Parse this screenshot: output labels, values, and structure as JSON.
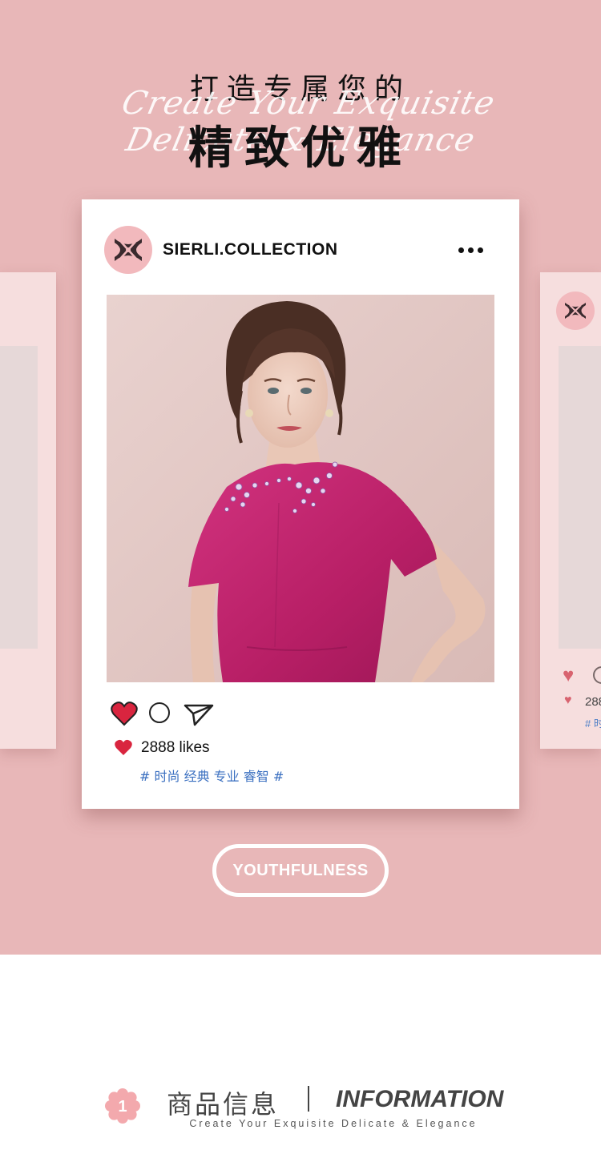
{
  "hero": {
    "title_line1": "打造专属您的",
    "script_text": "Create Your Exquisite Delicate & Elegance",
    "title_line2": "精致优雅"
  },
  "post": {
    "brand_name": "SIERLI.COLLECTION",
    "likes_text": "2888 likes",
    "hashtags": "# 时尚 经典 专业 睿智 #",
    "photo_icon": "fashion-model-photo"
  },
  "side_post": {
    "likes_text": "288",
    "hashtags": "# 时"
  },
  "pill_label": "YOUTHFULNESS",
  "info": {
    "badge_number": "1",
    "title_cn": "商品信息",
    "title_en": "INFORMATION",
    "subtitle": "Create Your Exquisite Delicate & Elegance"
  },
  "colors": {
    "background_pink": "#e8b7b8",
    "card_white": "#ffffff",
    "heart_red": "#d9253f",
    "hashtag_blue": "#3a6fc0",
    "dress_magenta": "#c0266f"
  }
}
